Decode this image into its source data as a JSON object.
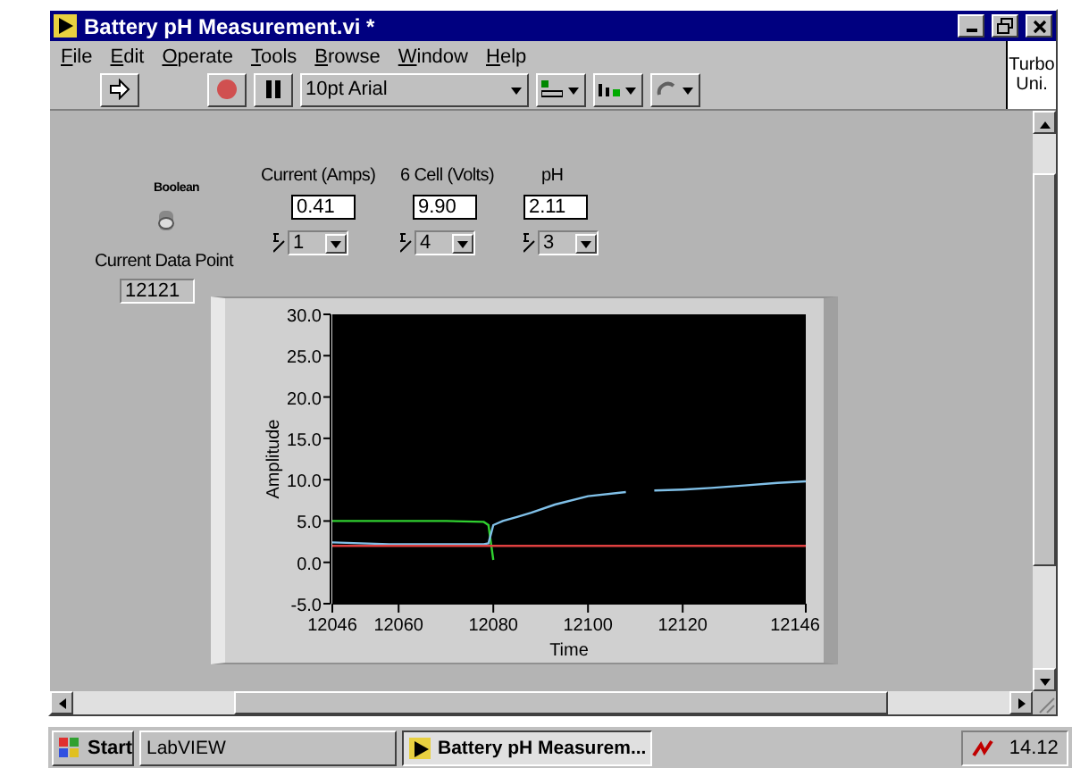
{
  "window": {
    "title": "Battery pH Measurement.vi *"
  },
  "menu": [
    "File",
    "Edit",
    "Operate",
    "Tools",
    "Browse",
    "Window",
    "Help"
  ],
  "toolbar": {
    "font": "10pt Arial"
  },
  "help_box": {
    "lines": [
      "Turbo",
      "Uni."
    ]
  },
  "front_panel": {
    "boolean": {
      "label": "Boolean",
      "on": false
    },
    "data_point": {
      "label": "Current Data Point",
      "value": "12121"
    },
    "indicators": [
      {
        "label": "Current (Amps)",
        "value": "0.41",
        "precision": "1"
      },
      {
        "label": "6 Cell (Volts)",
        "value": "9.90",
        "precision": "4"
      },
      {
        "label": "pH",
        "value": "2.11",
        "precision": "3"
      }
    ],
    "graph": {
      "chart_data": {
        "type": "line",
        "xlabel": "Time",
        "ylabel": "Amplitude",
        "x": [
          12046,
          12058,
          12070,
          12078,
          12079,
          12080,
          12082,
          12085,
          12088,
          12093,
          12100,
          12108,
          12110,
          12114,
          12120,
          12126,
          12133,
          12140,
          12146
        ],
        "series": [
          {
            "color": "#30d030",
            "values": [
              5.0,
              5.0,
              5.0,
              4.9,
              4.5,
              0.3,
              null,
              null,
              null,
              null,
              null,
              null,
              null,
              null,
              null,
              null,
              null,
              null,
              null
            ]
          },
          {
            "color": "#80c0e8",
            "values": [
              2.4,
              2.2,
              2.2,
              2.2,
              2.3,
              4.5,
              5.0,
              5.5,
              6.0,
              7.0,
              8.0,
              8.5,
              null,
              8.7,
              8.8,
              9.0,
              9.3,
              9.6,
              9.8
            ]
          },
          {
            "color": "#e04040",
            "values": [
              2.0,
              2.0,
              2.0,
              2.0,
              2.0,
              2.0,
              2.0,
              2.0,
              2.0,
              2.0,
              2.0,
              2.0,
              2.0,
              2.0,
              2.0,
              2.0,
              2.0,
              2.0,
              2.0
            ]
          }
        ],
        "xlim": [
          12046,
          12146
        ],
        "ylim": [
          -5,
          30
        ],
        "xticks": [
          12046,
          12060,
          12080,
          12100,
          12120,
          12146
        ],
        "yticks": [
          {
            "value": -5,
            "label": "-5.0"
          },
          {
            "value": 0,
            "label": "0.0"
          },
          {
            "value": 5,
            "label": "5.0"
          },
          {
            "value": 10,
            "label": "10.0"
          },
          {
            "value": 15,
            "label": "15.0"
          },
          {
            "value": 20,
            "label": "20.0"
          },
          {
            "value": 25,
            "label": "25.0"
          },
          {
            "value": 30,
            "label": "30.0"
          }
        ]
      }
    }
  },
  "taskbar": {
    "start": "Start",
    "tasks": [
      {
        "label": "LabVIEW",
        "selected": false
      },
      {
        "label": "Battery pH Measurem...",
        "selected": true
      }
    ],
    "clock": "14.12"
  }
}
